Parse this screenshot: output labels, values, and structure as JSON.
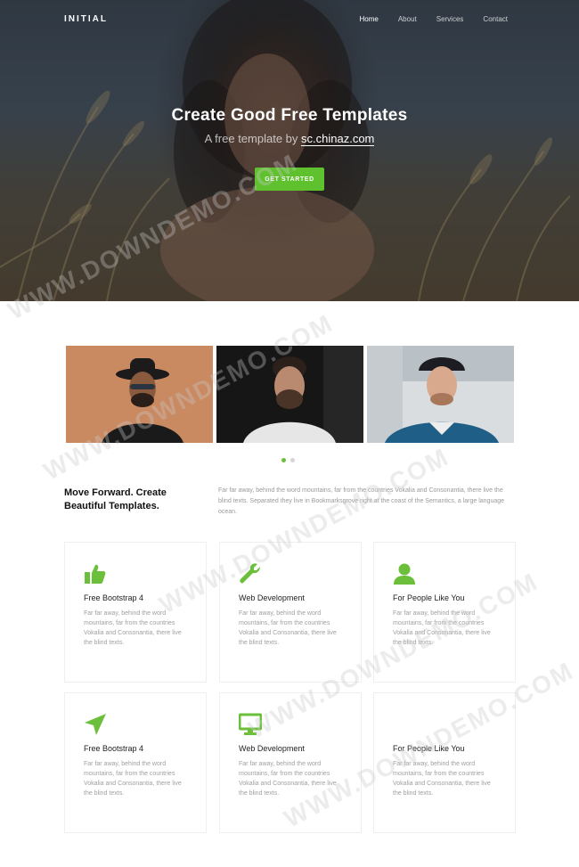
{
  "nav": {
    "brand": "INITIAL",
    "links": [
      "Home",
      "About",
      "Services",
      "Contact"
    ]
  },
  "hero": {
    "title": "Create Good Free Templates",
    "subtitle_prefix": "A free template by ",
    "subtitle_link": "sc.chinaz.com",
    "cta": "GET STARTED"
  },
  "gallery": {
    "photos": [
      "person-hat-sunglasses-photo",
      "person-beard-dark-photo",
      "person-cap-snow-photo"
    ],
    "dots": 2,
    "active_dot": 0
  },
  "intro": {
    "heading": "Move Forward. Create Beautiful Templates.",
    "text": "Far far away, behind the word mountains, far from the countries Vokalia and Consonantia, there live the blind texts. Separated they live in Bookmarksgrove right at the coast of the Semantics, a large language ocean."
  },
  "features": [
    {
      "icon": "thumbs-up-icon",
      "title": "Free Bootstrap 4",
      "text": "Far far away, behind the word mountains, far from the countries Vokalia and Consonantia, there live the blind texts."
    },
    {
      "icon": "wrench-icon",
      "title": "Web Development",
      "text": "Far far away, behind the word mountains, far from the countries Vokalia and Consonantia, there live the blind texts."
    },
    {
      "icon": "user-icon",
      "title": "For People Like You",
      "text": "Far far away, behind the word mountains, far from the countries Vokalia and Consonantia, there live the blind texts."
    },
    {
      "icon": "paper-plane-icon",
      "title": "Free Bootstrap 4",
      "text": "Far far away, behind the word mountains, far from the countries Vokalia and Consonantia, there live the blind texts."
    },
    {
      "icon": "monitor-icon",
      "title": "Web Development",
      "text": "Far far away, behind the word mountains, far from the countries Vokalia and Consonantia, there live the blind texts."
    },
    {
      "icon": "user-icon",
      "title": "For People Like You",
      "text": "Far far away, behind the word mountains, far from the countries Vokalia and Consonantia, there live the blind texts."
    }
  ],
  "watermark": "WWW.DOWNDEMO.COM",
  "colors": {
    "accent": "#5fc12d",
    "icon": "#6cbf3a",
    "heading": "#111111",
    "body_text": "#9a9a9a"
  }
}
